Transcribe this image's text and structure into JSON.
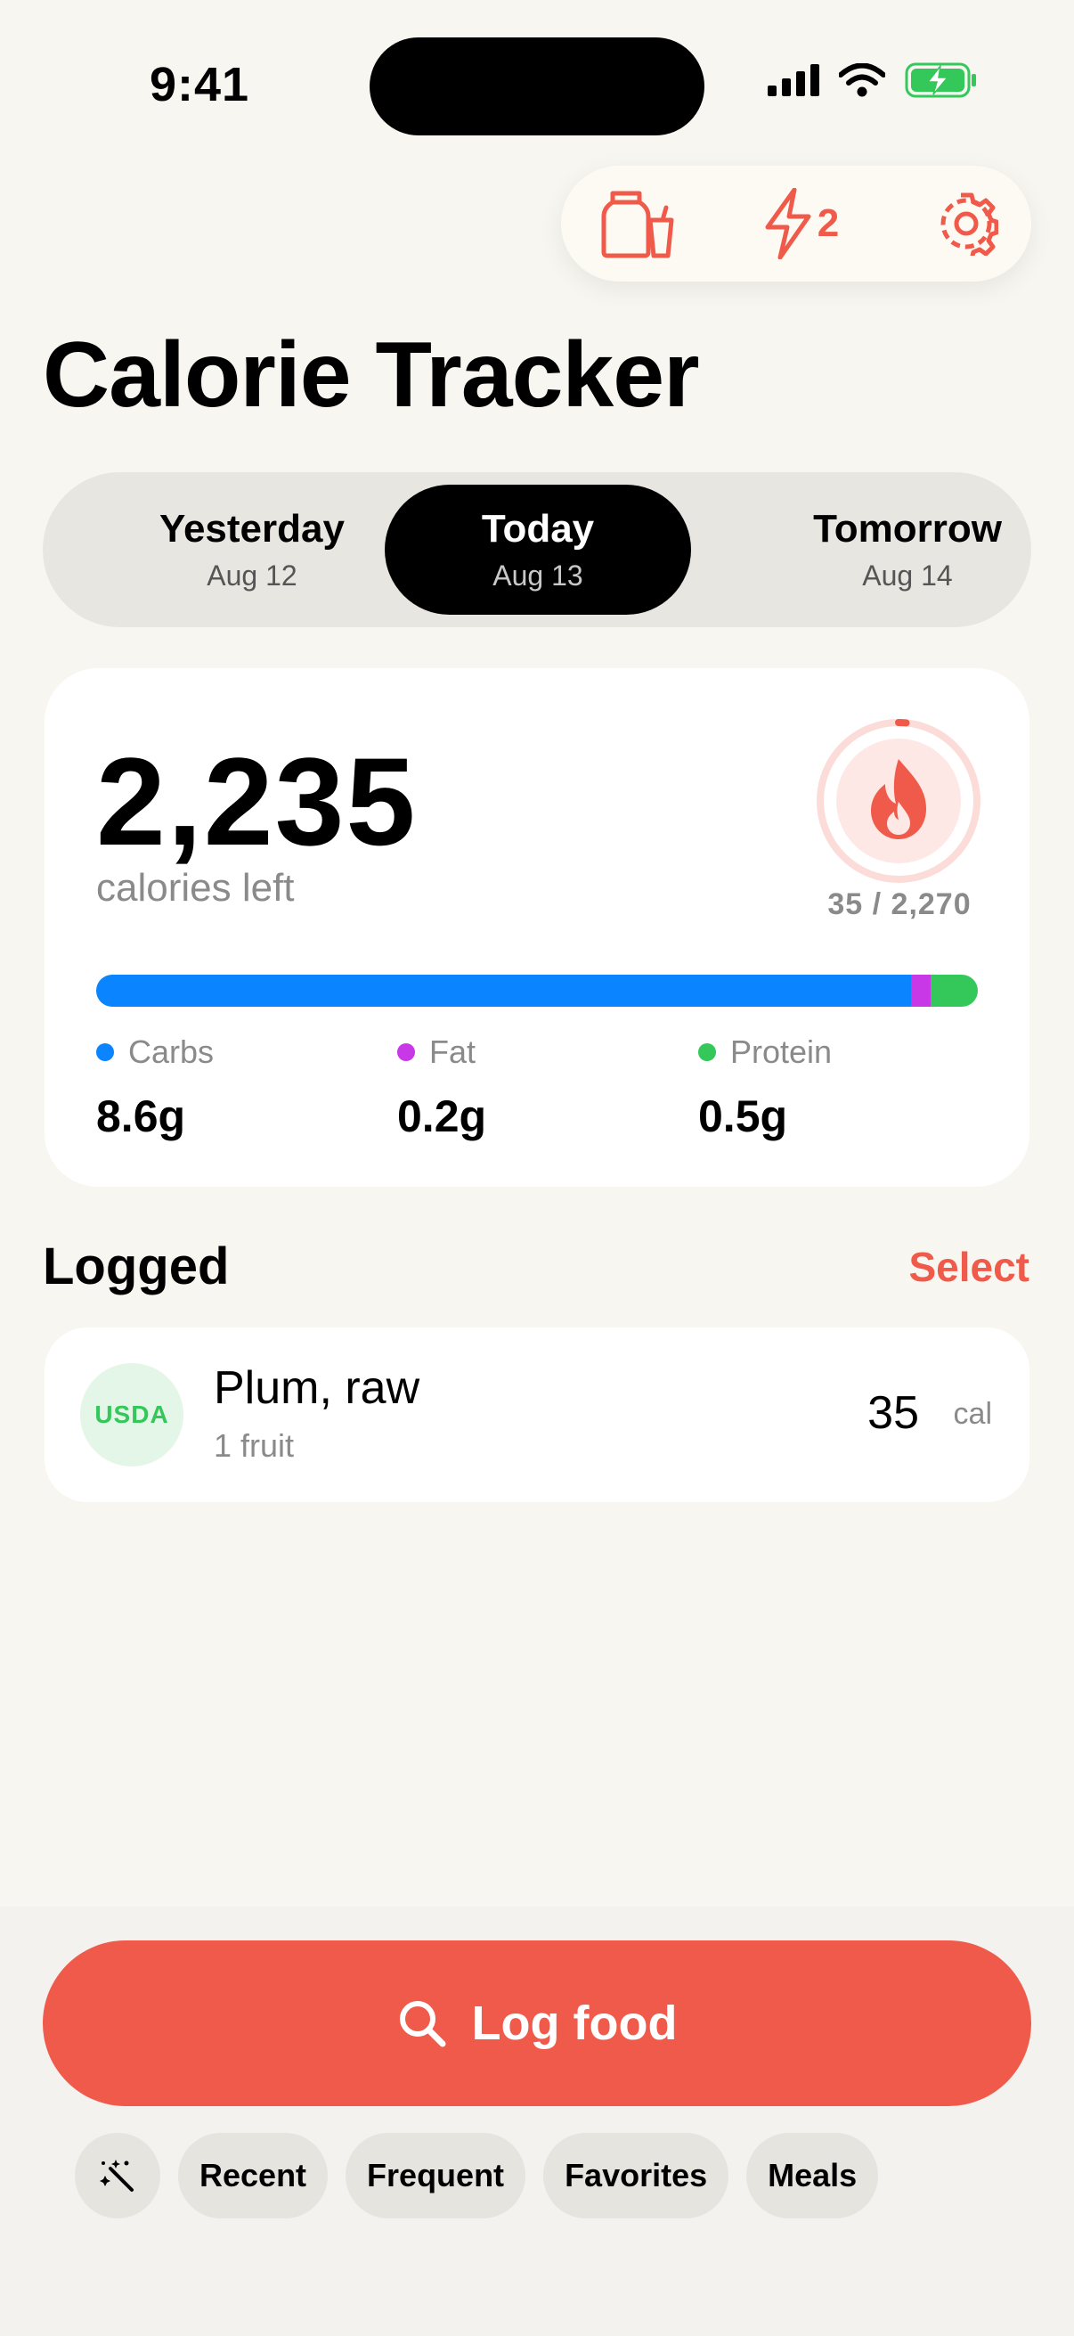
{
  "status_bar": {
    "time": "9:41"
  },
  "toolbar": {
    "streak_count": "2"
  },
  "header": {
    "title": "Calorie Tracker"
  },
  "day_selector": {
    "yesterday": {
      "label": "Yesterday",
      "date": "Aug 12"
    },
    "today": {
      "label": "Today",
      "date": "Aug 13"
    },
    "tomorrow": {
      "label": "Tomorrow",
      "date": "Aug 14"
    }
  },
  "summary": {
    "calories_left": "2,235",
    "calories_left_label": "calories left",
    "consumed_over_goal": "35 / 2,270",
    "consumed": 35,
    "goal": 2270,
    "macros": {
      "carbs": {
        "name": "Carbs",
        "value": "8.6g",
        "grams": 8.6,
        "color": "#0a84ff"
      },
      "fat": {
        "name": "Fat",
        "value": "0.2g",
        "grams": 0.2,
        "color": "#c938e6"
      },
      "protein": {
        "name": "Protein",
        "value": "0.5g",
        "grams": 0.5,
        "color": "#34c759"
      }
    }
  },
  "logged": {
    "title": "Logged",
    "select_label": "Select",
    "items": [
      {
        "source": "USDA",
        "name": "Plum, raw",
        "serving": "1 fruit",
        "calories": "35",
        "unit": "cal"
      }
    ]
  },
  "bottom": {
    "log_food_label": "Log food",
    "chips": [
      "Recent",
      "Frequent",
      "Favorites",
      "Meals"
    ]
  },
  "colors": {
    "accent": "#f05a4a",
    "background": "#f8f6f1"
  },
  "icons": [
    "jar-cup-icon",
    "lightning-icon",
    "gear-icon",
    "flame-icon",
    "search-icon",
    "magic-wand-icon"
  ]
}
